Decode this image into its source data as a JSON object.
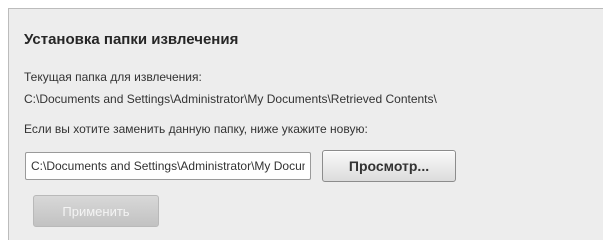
{
  "section": {
    "title": "Установка папки извлечения",
    "current_folder_label": "Текущая папка для извлечения:",
    "current_folder_path": "C:\\Documents and Settings\\Administrator\\My Documents\\Retrieved Contents\\",
    "change_hint": "Если вы хотите заменить данную папку, ниже укажите новую:"
  },
  "folder_input": {
    "value": "C:\\Documents and Settings\\Administrator\\My Documents\\Retrieved Contents\\"
  },
  "buttons": {
    "browse_label": "Просмотр...",
    "apply_label": "Применить",
    "apply_disabled": true
  }
}
